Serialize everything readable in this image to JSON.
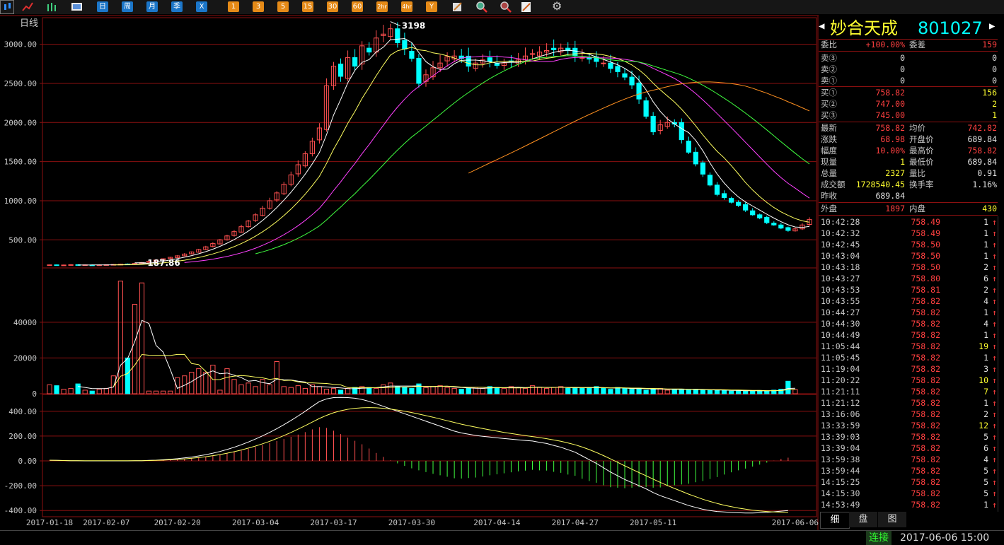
{
  "toolbar": {
    "buttons": [
      "日",
      "周",
      "月",
      "季",
      "X",
      "1",
      "3",
      "5",
      "15",
      "30",
      "60",
      "2hr",
      "4hr",
      "Y"
    ],
    "icons": [
      "candlestick-icon",
      "line-chart-icon",
      "bars-icon",
      "picture-icon",
      "brush-icon",
      "zoom-in-icon",
      "zoom-out-icon",
      "draw-icon",
      "gear-icon"
    ]
  },
  "chart": {
    "period_label": "日线",
    "high_label": "3198",
    "low_label": "187.86"
  },
  "colors": {
    "up": "#ff5050",
    "down": "#00ffff",
    "ma5": "#ffffff",
    "ma10": "#ffff60",
    "ma20": "#ff40ff",
    "ma30": "#40ff40",
    "ma60": "#ff9020",
    "grid": "#8b1010"
  },
  "chart_data": [
    {
      "type": "candlestick",
      "title": "日线",
      "yticks": [
        "3000.00",
        "2500.00",
        "2000.00",
        "1500.00",
        "1000.00",
        "500.00"
      ],
      "ytick_values": [
        3000,
        2500,
        2000,
        1500,
        1000,
        500
      ],
      "ylim": [
        150,
        3340
      ],
      "xticks": [
        "2017-01-18",
        "2017-02-07",
        "2017-02-20",
        "2017-03-04",
        "2017-03-17",
        "2017-03-30",
        "2017-04-14",
        "2017-04-27",
        "2017-05-11",
        "2017-06-06"
      ],
      "xtick_index": [
        0,
        8,
        18,
        29,
        40,
        51,
        63,
        74,
        85,
        105
      ],
      "closes": [
        180,
        174,
        178,
        182,
        177,
        180,
        176,
        179,
        182,
        185,
        188,
        187.86,
        198,
        210,
        225,
        242,
        258,
        276,
        295,
        318,
        345,
        375,
        410,
        452,
        500,
        550,
        605,
        668,
        740,
        820,
        905,
        1000,
        1100,
        1210,
        1330,
        1460,
        1600,
        1760,
        1930,
        2470,
        2720,
        2590,
        2830,
        2720,
        2980,
        2900,
        3080,
        3130,
        3198,
        3020,
        2940,
        2820,
        2500,
        2610,
        2700,
        2760,
        2840,
        2850,
        2820,
        2720,
        2760,
        2800,
        2780,
        2730,
        2760,
        2780,
        2800,
        2850,
        2880,
        2900,
        2920,
        2930,
        2950,
        2920,
        2850,
        2830,
        2810,
        2780,
        2760,
        2690,
        2650,
        2580,
        2480,
        2300,
        2080,
        1880,
        1970,
        2000,
        1980,
        1780,
        1620,
        1470,
        1340,
        1200,
        1080,
        1040,
        980,
        940,
        880,
        820,
        780,
        720,
        690,
        650,
        620,
        640,
        689.84,
        758.82
      ],
      "highs_lows": "approximate",
      "ma_periods": [
        5,
        10,
        20,
        30,
        60
      ]
    },
    {
      "type": "bar",
      "title": "volume",
      "yticks": [
        "40000",
        "20000",
        "0"
      ],
      "ytick_values": [
        40000,
        20000,
        0
      ],
      "ylim": [
        0,
        70000
      ],
      "values": [
        5000,
        4500,
        2500,
        3000,
        5500,
        2000,
        1500,
        2500,
        3000,
        10000,
        63000,
        20000,
        50000,
        62000,
        1500,
        1500,
        1500,
        1500,
        9000,
        10000,
        12000,
        14000,
        12000,
        16000,
        2000,
        14000,
        8000,
        5000,
        6000,
        4000,
        8000,
        5000,
        18000,
        4000,
        3500,
        4500,
        3000,
        5000,
        4000,
        2500,
        3000,
        2000,
        3000,
        3500,
        4000,
        3500,
        3000,
        5000,
        6000,
        4000,
        3500,
        3000,
        5500,
        3500,
        4000,
        4500,
        3500,
        3000,
        2500,
        3000,
        3500,
        3000,
        4000,
        3500,
        3000,
        4000,
        3500,
        3000,
        4500,
        3500,
        3000,
        3500,
        4000,
        3000,
        3500,
        3000,
        3500,
        4000,
        3000,
        2500,
        3500,
        3000,
        2500,
        3000,
        2000,
        2500,
        3000,
        2000,
        2500,
        2500,
        2000,
        2500,
        2000,
        2000,
        1800,
        2000,
        1500,
        1800,
        1500,
        1500,
        1800,
        1500,
        2000,
        2500,
        7000,
        2327
      ],
      "ma_periods": [
        5,
        10
      ]
    },
    {
      "type": "line",
      "title": "MACD",
      "yticks": [
        "400.00",
        "200.00",
        "0.00",
        "-200.00",
        "-400.00"
      ],
      "ytick_values": [
        400,
        200,
        0,
        -200,
        -400
      ],
      "ylim": [
        -450,
        530
      ],
      "dif": [
        5,
        4,
        3,
        2,
        1,
        0,
        0,
        0,
        0,
        0,
        0,
        0,
        1,
        2,
        4,
        6,
        9,
        13,
        18,
        24,
        31,
        40,
        50,
        62,
        76,
        92,
        110,
        130,
        152,
        176,
        202,
        230,
        260,
        292,
        326,
        362,
        400,
        440,
        478,
        500,
        510,
        512,
        510,
        505,
        495,
        480,
        460,
        440,
        420,
        400,
        380,
        360,
        340,
        320,
        300,
        280,
        260,
        240,
        225,
        215,
        205,
        198,
        192,
        186,
        180,
        175,
        170,
        165,
        160,
        150,
        140,
        125,
        110,
        90,
        70,
        40,
        10,
        -20,
        -55,
        -90,
        -120,
        -150,
        -175,
        -200,
        -225,
        -255,
        -280,
        -300,
        -320,
        -340,
        -360,
        -375,
        -390,
        -400,
        -408,
        -412,
        -415,
        -418,
        -420,
        -420,
        -418,
        -415,
        -410,
        -405,
        -400
      ],
      "dea": [
        5,
        4,
        3,
        2,
        2,
        1,
        1,
        1,
        1,
        1,
        1,
        1,
        1,
        2,
        3,
        4,
        6,
        9,
        12,
        16,
        21,
        27,
        34,
        42,
        51,
        62,
        74,
        88,
        103,
        120,
        138,
        158,
        180,
        204,
        229,
        256,
        284,
        313,
        342,
        367,
        388,
        404,
        416,
        424,
        428,
        430,
        428,
        424,
        418,
        410,
        400,
        390,
        378,
        365,
        352,
        338,
        324,
        310,
        296,
        284,
        272,
        261,
        250,
        240,
        230,
        221,
        212,
        204,
        196,
        188,
        179,
        169,
        158,
        145,
        130,
        112,
        91,
        68,
        43,
        16,
        -12,
        -40,
        -67,
        -94,
        -120,
        -147,
        -173,
        -198,
        -222,
        -245,
        -268,
        -289,
        -309,
        -327,
        -343,
        -357,
        -369,
        -380,
        -389,
        -397,
        -403,
        -408,
        -411,
        -413,
        -413
      ],
      "hist_note": "bars = 2*(dif-dea)"
    }
  ],
  "quote": {
    "title_name": "妙合天成",
    "title_code": "801027",
    "webi_label": "委比",
    "webi_value": "+100.00%",
    "weicha_label": "委差",
    "weicha_value": "159",
    "asks": [
      {
        "label": "卖③",
        "price": "0",
        "vol": "0"
      },
      {
        "label": "卖②",
        "price": "0",
        "vol": "0"
      },
      {
        "label": "卖①",
        "price": "0",
        "vol": "0"
      }
    ],
    "bids": [
      {
        "label": "买①",
        "price": "758.82",
        "vol": "156"
      },
      {
        "label": "买②",
        "price": "747.00",
        "vol": "2"
      },
      {
        "label": "买③",
        "price": "745.00",
        "vol": "1"
      }
    ],
    "stats": [
      {
        "l1": "最新",
        "v1": "758.82",
        "l2": "均价",
        "v2": "742.82"
      },
      {
        "l1": "涨跌",
        "v1": "68.98",
        "l2": "开盘价",
        "v2": "689.84"
      },
      {
        "l1": "幅度",
        "v1": "10.00%",
        "l2": "最高价",
        "v2": "758.82"
      },
      {
        "l1": "现量",
        "v1": "1",
        "l2": "最低价",
        "v2": "689.84"
      },
      {
        "l1": "总量",
        "v1": "2327",
        "l2": "量比",
        "v2": "0.91"
      },
      {
        "l1": "成交额",
        "v1": "1728540.45",
        "l2": "换手率",
        "v2": "1.16%"
      },
      {
        "l1": "昨收",
        "v1": "689.84",
        "l2": "",
        "v2": ""
      }
    ],
    "outer_label": "外盘",
    "outer_value": "1897",
    "inner_label": "内盘",
    "inner_value": "430",
    "ticks": [
      {
        "time": "10:42:28",
        "price": "758.49",
        "vol": "1"
      },
      {
        "time": "10:42:32",
        "price": "758.49",
        "vol": "1"
      },
      {
        "time": "10:42:45",
        "price": "758.50",
        "vol": "1"
      },
      {
        "time": "10:43:04",
        "price": "758.50",
        "vol": "1"
      },
      {
        "time": "10:43:18",
        "price": "758.50",
        "vol": "2"
      },
      {
        "time": "10:43:27",
        "price": "758.80",
        "vol": "6"
      },
      {
        "time": "10:43:53",
        "price": "758.81",
        "vol": "2"
      },
      {
        "time": "10:43:55",
        "price": "758.82",
        "vol": "4"
      },
      {
        "time": "10:44:27",
        "price": "758.82",
        "vol": "1"
      },
      {
        "time": "10:44:30",
        "price": "758.82",
        "vol": "4"
      },
      {
        "time": "10:44:49",
        "price": "758.82",
        "vol": "1"
      },
      {
        "time": "11:05:44",
        "price": "758.82",
        "vol": "19"
      },
      {
        "time": "11:05:45",
        "price": "758.82",
        "vol": "1"
      },
      {
        "time": "11:19:04",
        "price": "758.82",
        "vol": "3"
      },
      {
        "time": "11:20:22",
        "price": "758.82",
        "vol": "10"
      },
      {
        "time": "11:21:11",
        "price": "758.82",
        "vol": "7"
      },
      {
        "time": "11:21:12",
        "price": "758.82",
        "vol": "1"
      },
      {
        "time": "13:16:06",
        "price": "758.82",
        "vol": "2"
      },
      {
        "time": "13:33:59",
        "price": "758.82",
        "vol": "12"
      },
      {
        "time": "13:39:03",
        "price": "758.82",
        "vol": "5"
      },
      {
        "time": "13:39:04",
        "price": "758.82",
        "vol": "6"
      },
      {
        "time": "13:59:38",
        "price": "758.82",
        "vol": "4"
      },
      {
        "time": "13:59:44",
        "price": "758.82",
        "vol": "5"
      },
      {
        "time": "14:15:25",
        "price": "758.82",
        "vol": "5"
      },
      {
        "time": "14:15:30",
        "price": "758.82",
        "vol": "5"
      },
      {
        "time": "14:53:49",
        "price": "758.82",
        "vol": "1"
      }
    ],
    "tick_arrow": "↑"
  },
  "tabs": [
    "细",
    "盘",
    "图"
  ],
  "status": {
    "connection": "连接",
    "datetime": "2017-06-06 15:00"
  }
}
